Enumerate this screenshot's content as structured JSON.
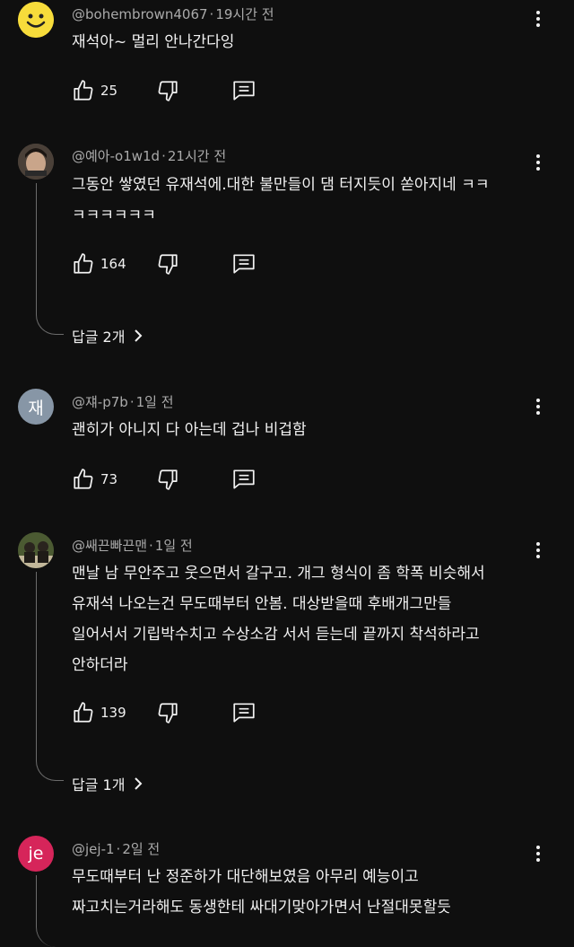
{
  "comments": [
    {
      "avatar_type": "smiley",
      "author": "@bohembrown4067",
      "time": "19시간 전",
      "lines": [
        "재석아~ 멀리 안나간다잉"
      ],
      "likes": "25"
    },
    {
      "avatar_type": "photo",
      "author": "@예아-o1w1d",
      "time": "21시간 전",
      "lines": [
        "그동안 쌓였던 유재석에.대한 불만들이 댐 터지듯이 쏟아지네 ㅋㅋ",
        "ㅋㅋㅋㅋㅋㅋ"
      ],
      "likes": "164",
      "replies": "답글 2개"
    },
    {
      "avatar_type": "letter",
      "avatar_letter": "재",
      "author": "@쟤-p7b",
      "time": "1일 전",
      "lines": [
        "괜히가 아니지 다 아는데  겁나 비겁함"
      ],
      "likes": "73"
    },
    {
      "avatar_type": "photo",
      "author": "@쌔끈빠끈맨",
      "time": "1일 전",
      "lines": [
        "맨날 남 무안주고 웃으면서 갈구고. 개그 형식이 좀 학폭 비슷해서",
        "유재석 나오는건 무도때부터 안봄. 대상받을때 후배개그만들",
        "일어서서 기립박수치고 수상소감 서서 듣는데 끝까지 착석하라고",
        "안하더라"
      ],
      "likes": "139",
      "replies": "답글 1개"
    },
    {
      "avatar_type": "letter",
      "avatar_letter": "je",
      "author": "@jej-1",
      "time": "2일 전",
      "lines": [
        "무도때부터 난 정준하가 대단해보였음 아무리 예능이고",
        "짜고치는거라해도 동생한테 싸대기맞아가면서 난절대못할듯"
      ]
    }
  ],
  "colors": {
    "background": "#0f0f0f",
    "text": "#f1f1f1",
    "meta": "#aaaaaa",
    "avatar_jae": "#8796a6",
    "avatar_je": "#d6255a"
  },
  "icons": {
    "like": "thumbs-up-icon",
    "dislike": "thumbs-down-icon",
    "reply": "comment-reply-icon",
    "more": "more-vert-icon",
    "chevron": "chevron-right-icon"
  }
}
